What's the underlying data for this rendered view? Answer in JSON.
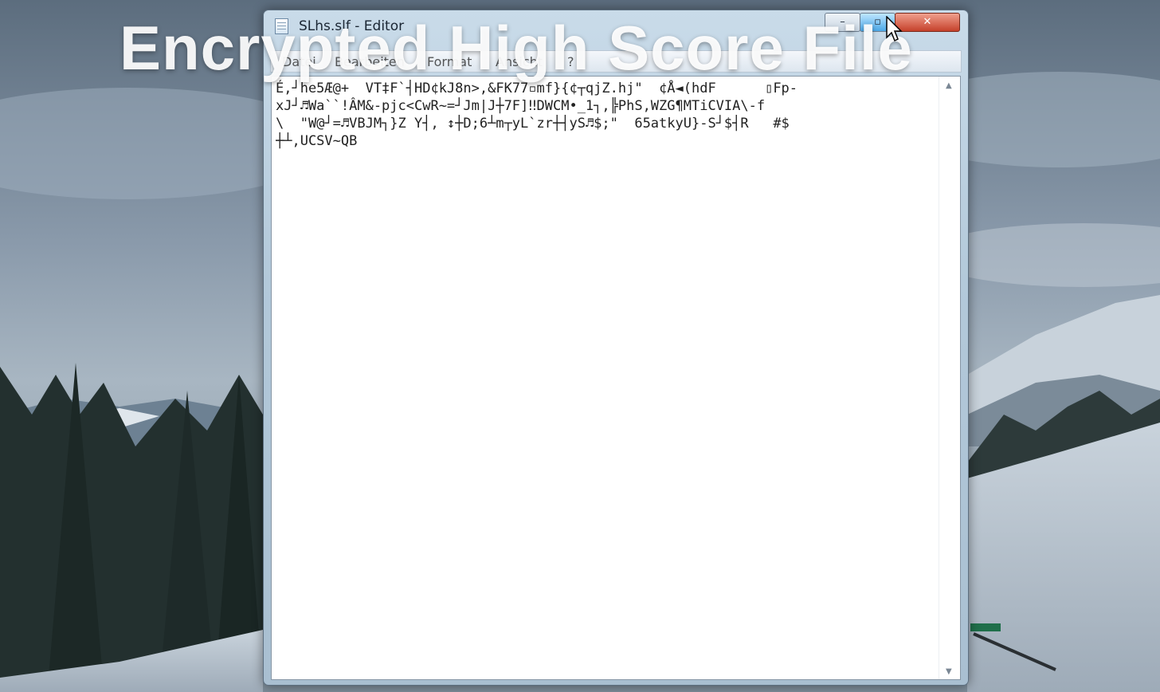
{
  "overlay": {
    "headline": "Encrypted High Score File"
  },
  "window": {
    "title": "SLhs.slf - Editor",
    "controls": {
      "minimize": "–",
      "maximize": "▫",
      "close": "✕"
    }
  },
  "menu": {
    "items": [
      "Datei",
      "Bearbeiten",
      "Format",
      "Ansicht",
      "?"
    ]
  },
  "document": {
    "content": "É,┘he5Æ@+  VT‡F`┤HD¢kJ8n>,&FK77▫mf}{¢┬qjZ.hj\"  ¢Å◄(hdF      ▯Fp-\nxJ┘♬Wa``!ÂM&-pjc<CwR~=┘Jm|J┼7F]‼DWCM•_1┐,╠PhS,WZG¶MTiCVIA\\-f\n\\  \"W@┘=♬VBJM┐}Z Y┤, ↕┼D;6┴m┬yL`zr┼┤yS♬$;\"  65atkyU}-S┘$┤R   #$\n┼┴,UCSV~QB"
  },
  "icons": [
    "notepad-icon",
    "minimize-icon",
    "maximize-icon",
    "close-icon",
    "scroll-up-arrow-icon",
    "scroll-down-arrow-icon",
    "mouse-cursor-icon"
  ],
  "colors": {
    "titlebar": "#b3c9da",
    "close_button": "#c5412b",
    "maximize_hover": "#4aa7e6",
    "editor_bg": "#ffffff"
  }
}
